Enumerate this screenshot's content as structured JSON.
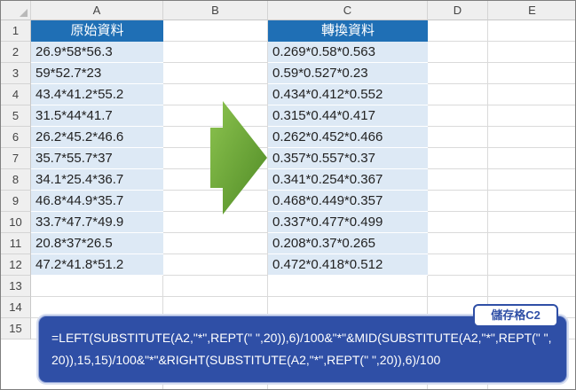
{
  "columns": [
    "A",
    "B",
    "C",
    "D",
    "E"
  ],
  "rows": [
    "1",
    "2",
    "3",
    "4",
    "5",
    "6",
    "7",
    "8",
    "9",
    "10",
    "11",
    "12",
    "13",
    "14",
    "15"
  ],
  "table_a": {
    "header": "原始資料",
    "values": [
      "26.9*58*56.3",
      "59*52.7*23",
      "43.4*41.2*55.2",
      "31.5*44*41.7",
      "26.2*45.2*46.6",
      "35.7*55.7*37",
      "34.1*25.4*36.7",
      "46.8*44.9*35.7",
      "33.7*47.7*49.9",
      "20.8*37*26.5",
      "47.2*41.8*51.2"
    ]
  },
  "table_c": {
    "header": "轉換資料",
    "values": [
      "0.269*0.58*0.563",
      "0.59*0.527*0.23",
      "0.434*0.412*0.552",
      "0.315*0.44*0.417",
      "0.262*0.452*0.466",
      "0.357*0.557*0.37",
      "0.341*0.254*0.367",
      "0.468*0.449*0.357",
      "0.337*0.477*0.499",
      "0.208*0.37*0.265",
      "0.472*0.418*0.512"
    ]
  },
  "callout": {
    "badge": "儲存格C2",
    "formula": "=LEFT(SUBSTITUTE(A2,\"*\",REPT(\" \",20)),6)/100&\"*\"&MID(SUBSTITUTE(A2,\"*\",REPT(\" \",20)),15,15)/100&\"*\"&RIGHT(SUBSTITUTE(A2,\"*\",REPT(\" \",20)),6)/100"
  },
  "colors": {
    "header_blue": "#1f6fb5",
    "cell_fill": "#dde9f5",
    "callout_blue": "#2f4fa6",
    "arrow_green": "#6aa63a"
  },
  "icons": [
    "right-arrow-icon"
  ]
}
